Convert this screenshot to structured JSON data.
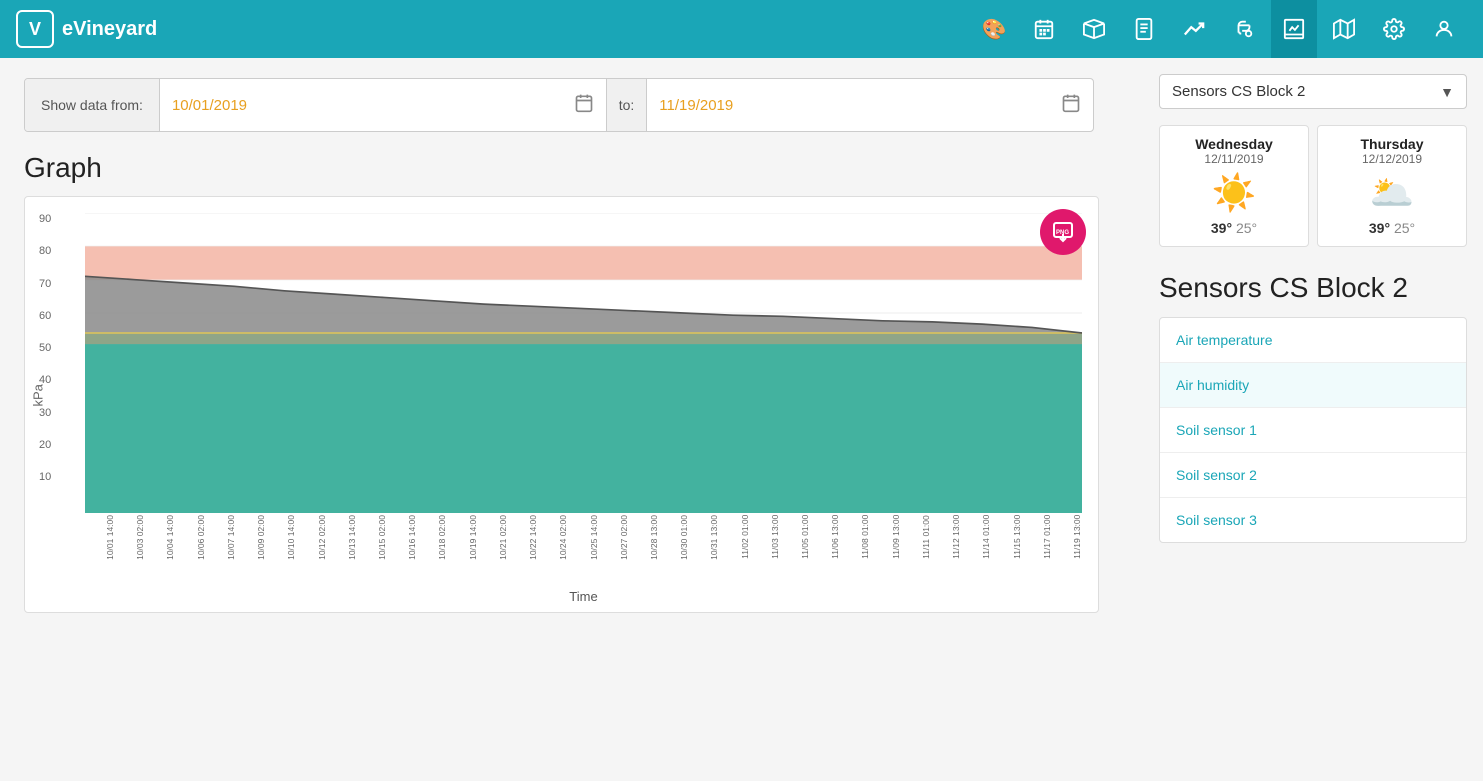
{
  "app": {
    "name": "eVineyard",
    "logo_letter": "V"
  },
  "nav": {
    "icons": [
      {
        "name": "palette-icon",
        "symbol": "🎨",
        "active": false
      },
      {
        "name": "calendar-icon",
        "symbol": "📅",
        "active": false
      },
      {
        "name": "box-icon",
        "symbol": "📦",
        "active": false
      },
      {
        "name": "document-icon",
        "symbol": "📄",
        "active": false
      },
      {
        "name": "trending-icon",
        "symbol": "📈",
        "active": false
      },
      {
        "name": "faucet-icon",
        "symbol": "🚿",
        "active": false
      },
      {
        "name": "chart-icon",
        "symbol": "📊",
        "active": true
      },
      {
        "name": "map-icon",
        "symbol": "🗺",
        "active": false
      },
      {
        "name": "settings-icon",
        "symbol": "⚙",
        "active": false
      },
      {
        "name": "user-icon",
        "symbol": "👤",
        "active": false
      }
    ]
  },
  "date_filter": {
    "label": "Show data from:",
    "from_value": "10/01/2019",
    "to_label": "to:",
    "to_value": "11/19/2019"
  },
  "graph": {
    "title": "Graph",
    "y_axis_label": "kPa",
    "x_axis_label": "Time",
    "y_ticks": [
      "10",
      "20",
      "30",
      "40",
      "50",
      "60",
      "70",
      "80",
      "90"
    ],
    "x_ticks": [
      "10/01 14:00",
      "10/03 02:00",
      "10/04 14:00",
      "10/06 02:00",
      "10/07 14:00",
      "10/09 02:00",
      "10/10 14:00",
      "10/12 02:00",
      "10/13 14:00",
      "10/15 02:00",
      "10/16 14:00",
      "10/18 02:00",
      "10/19 14:00",
      "10/21 02:00",
      "10/22 14:00",
      "10/24 02:00",
      "10/25 14:00",
      "10/27 02:00",
      "10/28 13:00",
      "10/30 01:00",
      "10/31 13:00",
      "11/02 01:00",
      "11/03 13:00",
      "11/05 01:00",
      "11/06 13:00",
      "11/08 01:00",
      "11/09 13:00",
      "11/11 01:00",
      "11/12 13:00",
      "11/14 01:00",
      "11/15 13:00",
      "11/17 01:00",
      "11/19 13:00"
    ],
    "png_label": "PNG",
    "colors": {
      "salmon": "#f4b8a8",
      "gray": "#8a8a8a",
      "teal": "#3ab5a0",
      "yellow": "#d4c060",
      "olive": "#8aaa80"
    }
  },
  "sensor_dropdown": {
    "label": "Sensors CS Block 2",
    "arrow": "▼"
  },
  "weather": {
    "days": [
      {
        "day": "Wednesday",
        "date": "12/11/2019",
        "icon": "☀️",
        "high": "39°",
        "low": "25°"
      },
      {
        "day": "Thursday",
        "date": "12/12/2019",
        "icon": "🌥",
        "high": "39°",
        "low": "25°"
      }
    ]
  },
  "sensors_block": {
    "title": "Sensors CS Block 2",
    "items": [
      {
        "label": "Air temperature"
      },
      {
        "label": "Air humidity"
      },
      {
        "label": "Soil sensor 1"
      },
      {
        "label": "Soil sensor 2"
      },
      {
        "label": "Soil sensor 3"
      }
    ]
  }
}
